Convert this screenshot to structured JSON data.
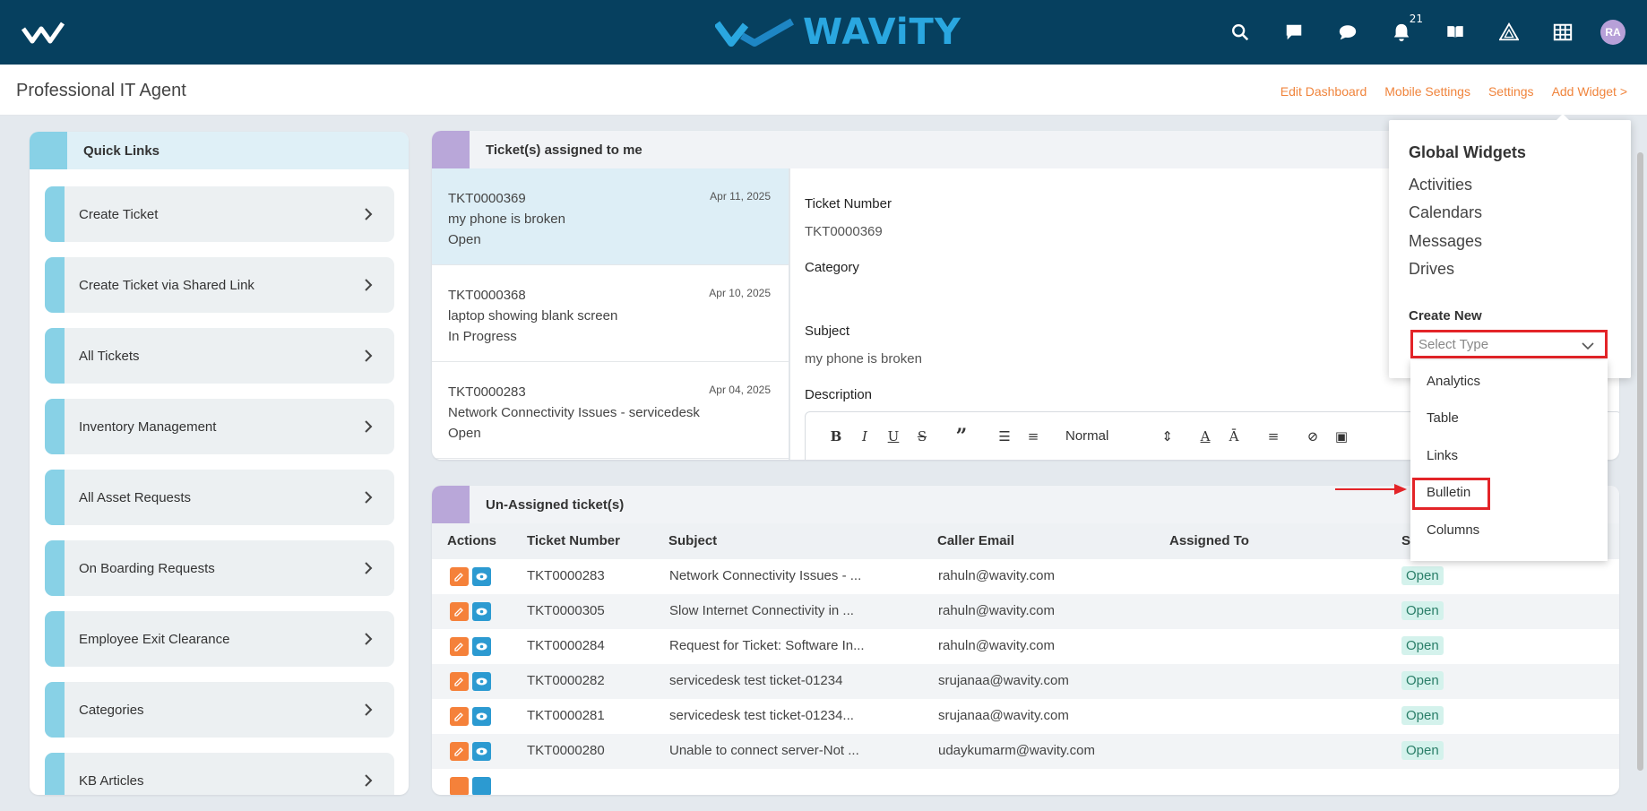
{
  "header": {
    "brand": "WAViTY",
    "notification_count": "21",
    "avatar_initials": "RA",
    "icons": [
      "search-icon",
      "chat-square-icon",
      "chat-bubble-icon",
      "bell-icon",
      "book-icon",
      "triangle-icon",
      "grid-icon"
    ]
  },
  "subheader": {
    "title": "Professional IT Agent",
    "links": {
      "edit_dashboard": "Edit Dashboard",
      "mobile_settings": "Mobile Settings",
      "settings": "Settings",
      "add_widget": "Add Widget >"
    }
  },
  "quick_links": {
    "title": "Quick Links",
    "items": [
      "Create Ticket",
      "Create Ticket via Shared Link",
      "All Tickets",
      "Inventory Management",
      "All Asset Requests",
      "On Boarding Requests",
      "Employee Exit Clearance",
      "Categories",
      "KB Articles"
    ]
  },
  "assigned": {
    "title": "Ticket(s) assigned to me",
    "tickets": [
      {
        "number": "TKT0000369",
        "date": "Apr 11, 2025",
        "subject": "my phone is broken",
        "status": "Open"
      },
      {
        "number": "TKT0000368",
        "date": "Apr 10, 2025",
        "subject": "laptop showing blank screen",
        "status": "In Progress"
      },
      {
        "number": "TKT0000283",
        "date": "Apr 04, 2025",
        "subject": "Network Connectivity Issues - servicedesk",
        "status": "Open"
      }
    ],
    "detail": {
      "ticket_number_label": "Ticket Number",
      "ticket_number": "TKT0000369",
      "category_label": "Category",
      "subject_label": "Subject",
      "subject": "my phone is broken",
      "description_label": "Description",
      "editor_style": "Normal"
    }
  },
  "unassigned": {
    "title": "Un-Assigned ticket(s)",
    "columns": {
      "actions": "Actions",
      "number": "Ticket Number",
      "subject": "Subject",
      "email": "Caller Email",
      "assigned": "Assigned To",
      "status": "S"
    },
    "rows": [
      {
        "number": "TKT0000283",
        "subject": "Network Connectivity Issues - ...",
        "email": "rahuln@wavity.com",
        "status": "Open"
      },
      {
        "number": "TKT0000305",
        "subject": "Slow Internet Connectivity in ...",
        "email": "rahuln@wavity.com",
        "status": "Open"
      },
      {
        "number": "TKT0000284",
        "subject": "Request for Ticket: Software In...",
        "email": "rahuln@wavity.com",
        "status": "Open"
      },
      {
        "number": "TKT0000282",
        "subject": "servicedesk test ticket-01234",
        "email": "srujanaa@wavity.com",
        "status": "Open"
      },
      {
        "number": "TKT0000281",
        "subject": "servicedesk test ticket-01234...",
        "email": "srujanaa@wavity.com",
        "status": "Open"
      },
      {
        "number": "TKT0000280",
        "subject": "Unable to connect server-Not ...",
        "email": "udaykumarm@wavity.com",
        "status": "Open"
      }
    ]
  },
  "widget_menu": {
    "global_title": "Global Widgets",
    "global_items": [
      "Activities",
      "Calendars",
      "Messages",
      "Drives"
    ],
    "create_new_label": "Create New",
    "select_placeholder": "Select Type",
    "options": [
      "Analytics",
      "Table",
      "Links",
      "Bulletin",
      "Columns"
    ]
  },
  "colors": {
    "topbar": "#06405f",
    "accent_orange": "#f0843c",
    "highlight_red": "#e32428",
    "quick_link_accent": "#88d1e6",
    "widget_accent": "#b9a7d9"
  }
}
